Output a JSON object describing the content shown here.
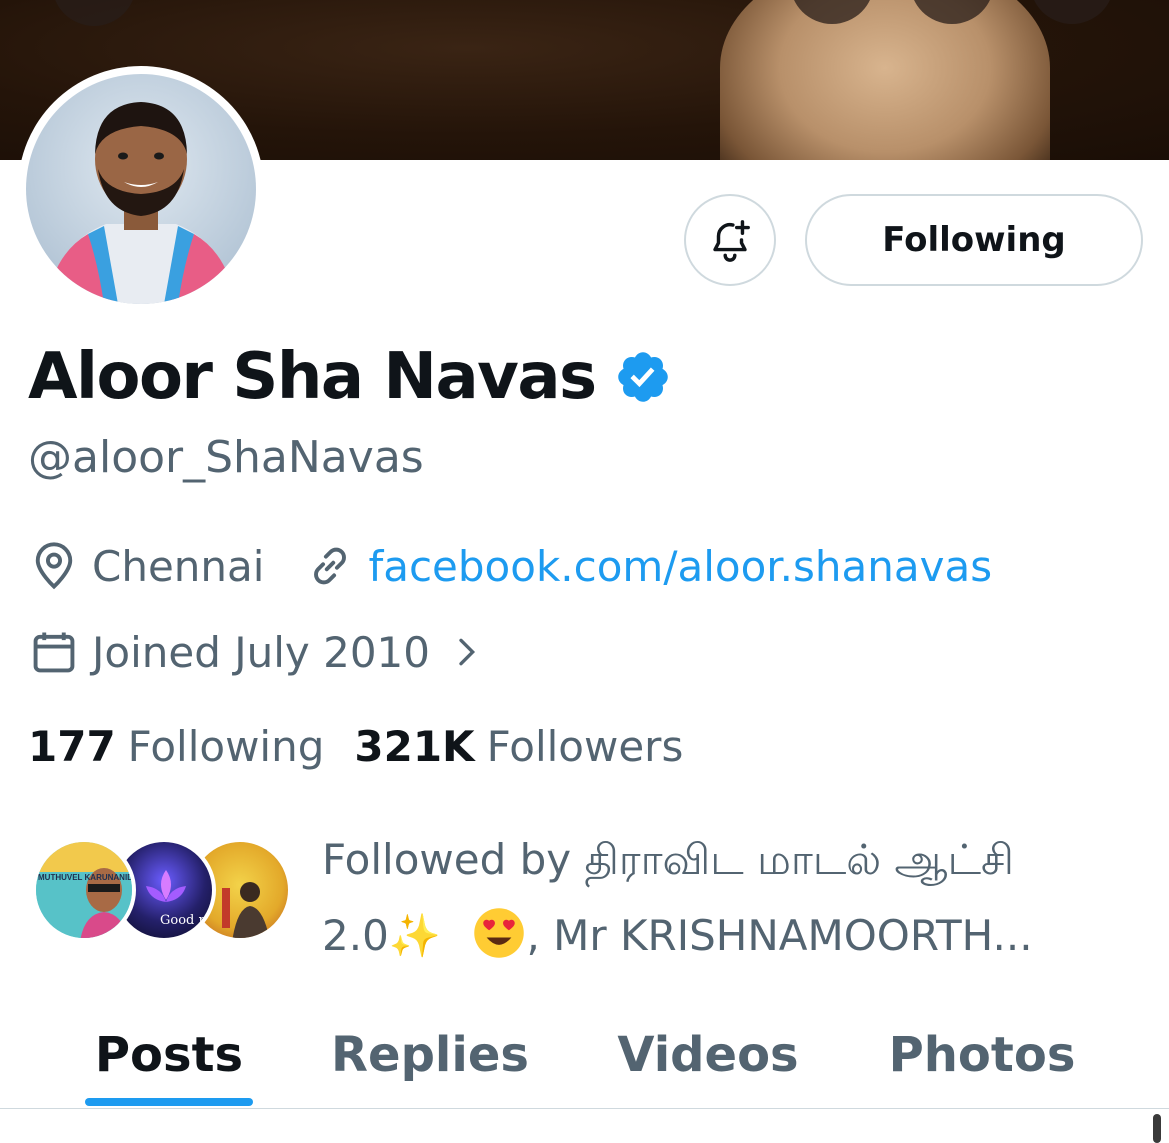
{
  "profile": {
    "name": "Aloor Sha Navas",
    "handle": "@aloor_ShaNavas",
    "verified": true,
    "location": "Chennai",
    "website": "facebook.com/aloor.shanavas",
    "joined": "Joined July 2010",
    "following_count": "177",
    "following_label": "Following",
    "followers_count": "321K",
    "followers_label": "Followers"
  },
  "actions": {
    "notify_icon": "bell-plus-icon",
    "follow_label": "Following"
  },
  "followed_by": {
    "line1": "Followed by திராவிட மாடல் ஆட்சி",
    "line2_prefix": "2.0",
    "sparkle": "✨",
    "emoji": "😍",
    "line2_suffix": ", Mr KRISHNAMOORTH...",
    "avatar_text_1": "MUTHUVEL KARUNANIDHI STALIN",
    "avatar_text_2": "Good night"
  },
  "tabs": [
    "Posts",
    "Replies",
    "Videos",
    "Photos"
  ],
  "active_tab": "Posts",
  "colors": {
    "accent": "#1d9bf0",
    "text_primary": "#0f1419",
    "text_secondary": "#536471",
    "border": "#cfd9de"
  }
}
